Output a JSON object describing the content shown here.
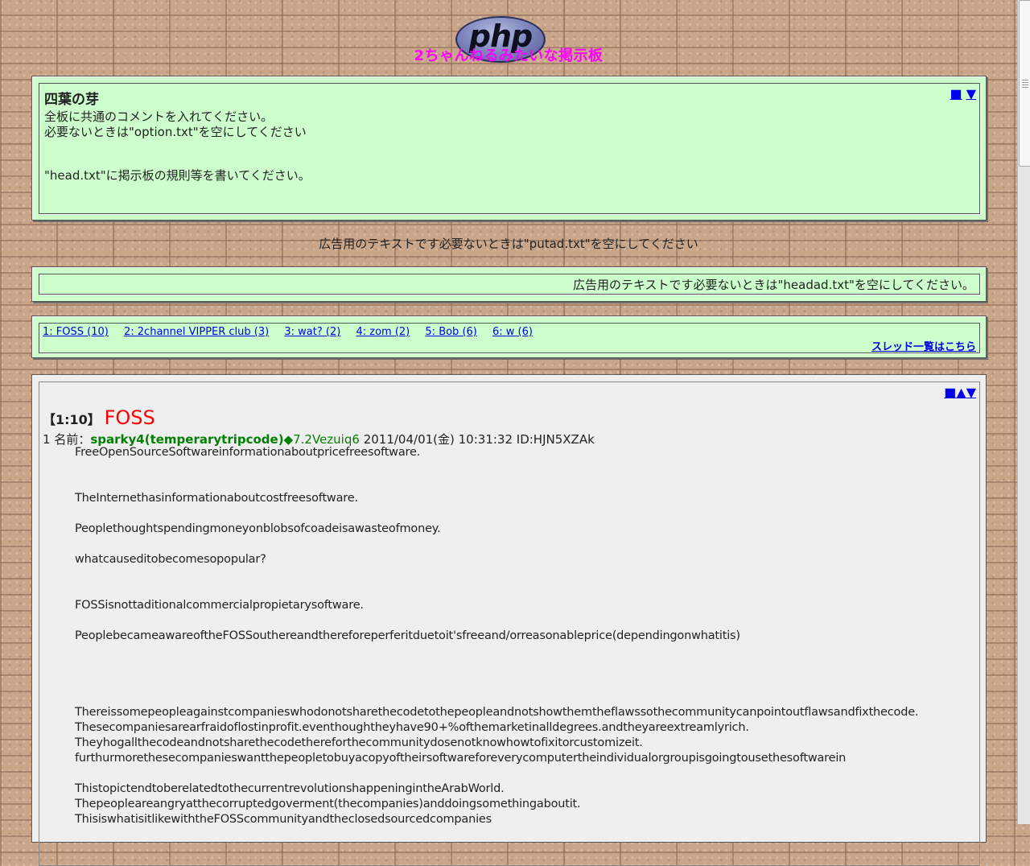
{
  "header": {
    "logo_text": "php",
    "board_title": "2ちゃんねるみたいな掲示板"
  },
  "head_panel": {
    "title": "四葉の芽",
    "lines": [
      "全板に共通のコメントを入れてください。",
      "必要ないときは\"option.txt\"を空にしてください",
      "\"head.txt\"に掲示板の規則等を書いてください。"
    ],
    "nav": [
      "■",
      "▼"
    ]
  },
  "putad_text": "広告用のテキストです必要ないときは\"putad.txt\"を空にしてください",
  "headad_text": "広告用のテキストです必要ないときは\"headad.txt\"を空にしてください。",
  "thread_list": {
    "items": [
      {
        "num": "1:",
        "title": "FOSS (10)"
      },
      {
        "num": "2:",
        "title": "2channel VIPPER club (3)"
      },
      {
        "num": "3:",
        "title": "wat? (2)"
      },
      {
        "num": "4:",
        "title": "zom (2)"
      },
      {
        "num": "5:",
        "title": "Bob (6)"
      },
      {
        "num": "6:",
        "title": "w (6)"
      }
    ],
    "all_threads_link": "スレッド一覧はこちら"
  },
  "thread": {
    "number": "【1:10】",
    "title": "FOSS",
    "nav": [
      "■",
      "▲",
      "▼"
    ],
    "post": {
      "num": "1",
      "name_label": "名前：",
      "name": "sparky4(temperarytripcode)",
      "trip": "◆7.2Vezuiq6",
      "datetime": "2011/04/01(金) 10:31:32",
      "id": "ID:HJN5XZAk",
      "lines": [
        "FreeOpenSourceSoftwareinformationaboutpricefreesoftware.",
        "",
        "",
        "TheInternethasinformationaboutcostfreesoftware.",
        "",
        "Peoplethoughtspendingmoneyonblobsofcoadeisawasteofmoney.",
        "",
        "whatcauseditobecomesopopular?",
        "",
        "",
        "FOSSisnottaditionalcommercialpropietarysoftware.",
        "",
        "PeoplebecameawareoftheFOSSouthereandthereforeperferitduetoit'sfreeand/orreasonableprice(dependingonwhatitis)",
        "",
        "",
        "",
        "",
        "Thereissomepeopleagainstcompanieswhodonotsharethecodetothepeopleandnotshowthemtheflawssothecommunitycanpointoutflawsandfixthecode.",
        "Thesecompaniesarearfraidoflostinprofit.eventhoughtheyhave90+%ofthemarketinalldegrees.andtheyareextreamlyrich.",
        "Theyhogallthecodeandnotsharethecodethereforthecommunitydosenotknowhowtofixitorcustomizeit.",
        "furthurmorethesecompanieswantthepeopletobuyacopyoftheirsoftwareforeverycomputertheindividualorgroupisgoingtousethesoftwarein",
        "",
        "ThistopictendtoberelatedtothecurrentrevolutionshappeningintheArabWorld.",
        "Thepeopleareangryatthecorruptedgoverment(thecompanies)anddoingsomethingaboutit.",
        "ThisiswhatisitlikewiththeFOSScommunityandtheclosedsourcedcompanies"
      ]
    }
  }
}
